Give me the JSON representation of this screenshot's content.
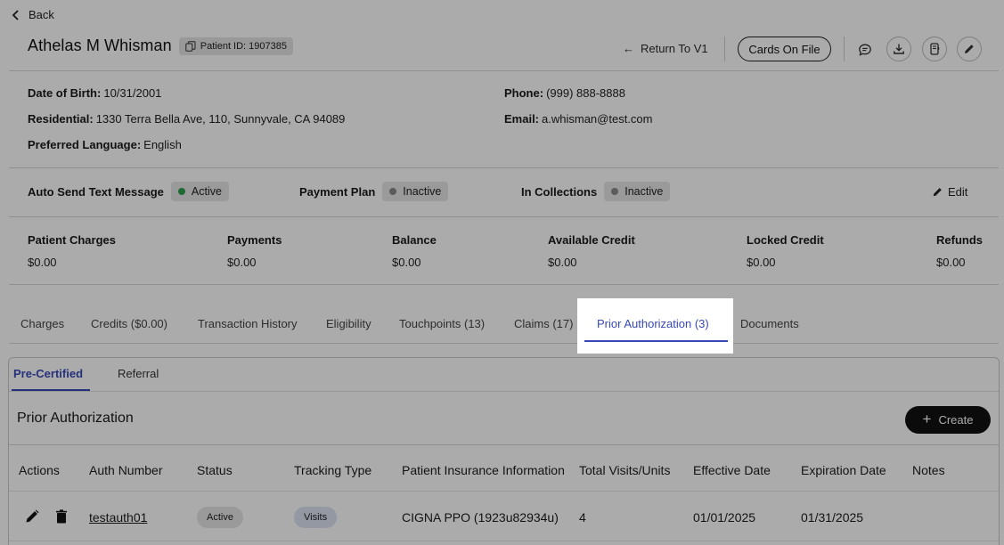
{
  "header": {
    "back_label": "Back",
    "patient_name": "Athelas M Whisman",
    "patient_id_label": "Patient ID: 1907385",
    "return_label": "Return To V1",
    "cards_label": "Cards On File"
  },
  "info": {
    "dob_label": "Date of Birth:",
    "dob_value": "10/31/2001",
    "residential_label": "Residential:",
    "residential_value": "1330 Terra Bella Ave, 110, Sunnyvale, CA 94089",
    "language_label": "Preferred Language:",
    "language_value": "English",
    "phone_label": "Phone:",
    "phone_value": "(999) 888-8888",
    "email_label": "Email:",
    "email_value": "a.whisman@test.com"
  },
  "status": {
    "auto_text_label": "Auto Send Text Message",
    "auto_text_value": "Active",
    "payment_plan_label": "Payment Plan",
    "payment_plan_value": "Inactive",
    "collections_label": "In Collections",
    "collections_value": "Inactive",
    "edit_label": "Edit",
    "active_color": "#2e9e4f",
    "inactive_color": "#8a8a8a"
  },
  "finance": [
    {
      "label": "Patient Charges",
      "value": "$0.00"
    },
    {
      "label": "Payments",
      "value": "$0.00"
    },
    {
      "label": "Balance",
      "value": "$0.00"
    },
    {
      "label": "Available Credit",
      "value": "$0.00"
    },
    {
      "label": "Locked Credit",
      "value": "$0.00"
    },
    {
      "label": "Refunds",
      "value": "$0.00"
    }
  ],
  "tabs": [
    {
      "label": "Charges"
    },
    {
      "label": "Credits ($0.00)"
    },
    {
      "label": "Transaction History"
    },
    {
      "label": "Eligibility"
    },
    {
      "label": "Touchpoints (13)"
    },
    {
      "label": "Claims (17)"
    },
    {
      "label": "Prior Authorization (3)"
    },
    {
      "label": "Documents"
    }
  ],
  "subtabs": {
    "pre_certified": "Pre-Certified",
    "referral": "Referral"
  },
  "panel": {
    "title": "Prior Authorization",
    "create_label": "Create"
  },
  "table": {
    "headers": [
      "Actions",
      "Auth Number",
      "Status",
      "Tracking Type",
      "Patient Insurance Information",
      "Total Visits/Units",
      "Effective Date",
      "Expiration Date",
      "Notes"
    ],
    "rows": [
      {
        "auth_number": "testauth01",
        "status": "Active",
        "tracking_type": "Visits",
        "insurance": "CIGNA PPO (1923u82934u)",
        "total_visits": "4",
        "effective_date": "01/01/2025",
        "expiration_date": "01/31/2025",
        "notes": ""
      }
    ]
  },
  "colors": {
    "accent": "#3849b6",
    "overlay": "rgba(0,0,0,0.33)"
  }
}
